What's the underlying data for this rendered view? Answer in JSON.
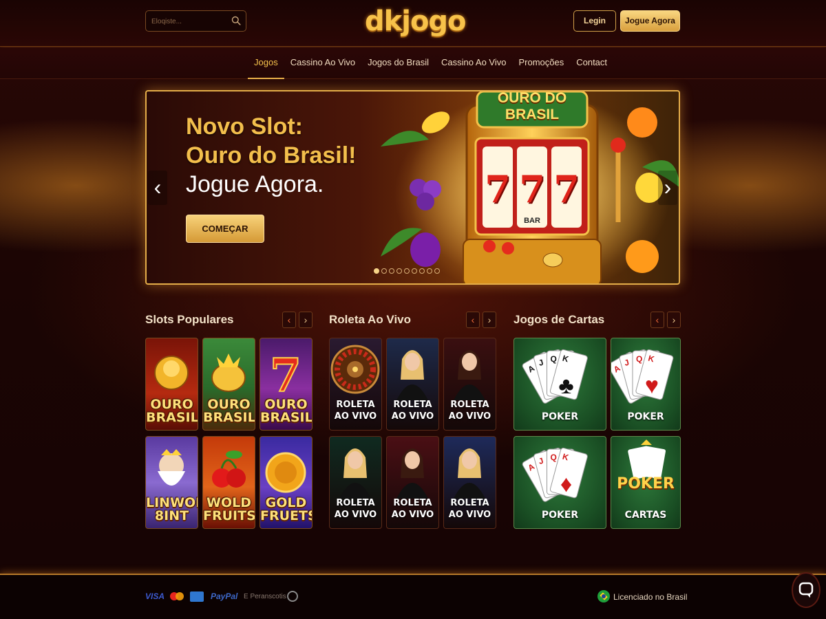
{
  "header": {
    "search_placeholder": "Eloqiste...",
    "logo": "dkjogo",
    "login_label": "Legin",
    "play_label": "Jogue Agora"
  },
  "nav": {
    "items": [
      {
        "label": "Jogos",
        "active": true
      },
      {
        "label": "Cassino Ao Vivo",
        "active": false
      },
      {
        "label": "Jogos do Brasil",
        "active": false
      },
      {
        "label": "Cassino Ao Vivo",
        "active": false
      },
      {
        "label": "Promoções",
        "active": false
      },
      {
        "label": "Contact",
        "active": false
      }
    ]
  },
  "hero": {
    "title_line1": "Novo Slot:",
    "title_line2": "Ouro do Brasil!",
    "title_line3": "Jogue Agora.",
    "cta_label": "COMEÇAR",
    "slot_sign": "OURO DO BRASIL",
    "reel_symbols": [
      "7",
      "7",
      "7"
    ],
    "reel_bar": "BAR",
    "slide_count": 9,
    "active_slide": 1
  },
  "sections": {
    "slots": {
      "title": "Slots Populares",
      "items": [
        {
          "label_1": "OURO",
          "label_2": "BRASIL",
          "icon": "golden-buddha-icon"
        },
        {
          "label_1": "OURO",
          "label_2": "BRASIL",
          "icon": "gold-pot-icon"
        },
        {
          "label_1": "OURO",
          "label_2": "BRASIL",
          "icon": "lucky-seven-icon"
        },
        {
          "label_1": "LINWORD",
          "label_2": "8INT",
          "icon": "zeus-icon"
        },
        {
          "label_1": "WOLD",
          "label_2": "FRUITS",
          "icon": "cherry-icon"
        },
        {
          "label_1": "GOLD",
          "label_2": "FRUETS",
          "icon": "gold-coin-icon"
        }
      ]
    },
    "roleta": {
      "title": "Roleta Ao Vivo",
      "items": [
        {
          "label_1": "ROLETA",
          "label_2": "AO VIVO",
          "icon": "roulette-wheel-icon"
        },
        {
          "label_1": "ROLETA",
          "label_2": "AO VIVO",
          "icon": "live-dealer-icon"
        },
        {
          "label_1": "ROLETA",
          "label_2": "AO VIVO",
          "icon": "live-dealer-icon"
        },
        {
          "label_1": "ROLETA",
          "label_2": "AO VIVO",
          "icon": "live-dealer-icon"
        },
        {
          "label_1": "ROLETA",
          "label_2": "AO VIVO",
          "icon": "live-dealer-icon"
        },
        {
          "label_1": "ROLETA",
          "label_2": "AO VIVO",
          "icon": "live-dealer-icon"
        }
      ]
    },
    "cartas": {
      "title": "Jogos de Cartas",
      "items": [
        {
          "label": "POKER",
          "icon": "playing-cards-clubs-icon",
          "badge": ""
        },
        {
          "label": "POKER",
          "icon": "playing-cards-hearts-icon",
          "badge": ""
        },
        {
          "label": "POKER",
          "icon": "playing-cards-diamonds-icon",
          "badge": ""
        },
        {
          "label": "CARTAS",
          "icon": "poker-logo-icon",
          "badge": "POKER"
        }
      ]
    }
  },
  "footer": {
    "payments": [
      "VISA",
      "mastercard",
      "amex",
      "PayPal",
      "E Peranscotis"
    ],
    "license": "Licenciado no Brasil"
  },
  "colors": {
    "accent_gold": "#f3bf4c",
    "background": "#1a0505",
    "felt_green": "#1a4f24"
  }
}
